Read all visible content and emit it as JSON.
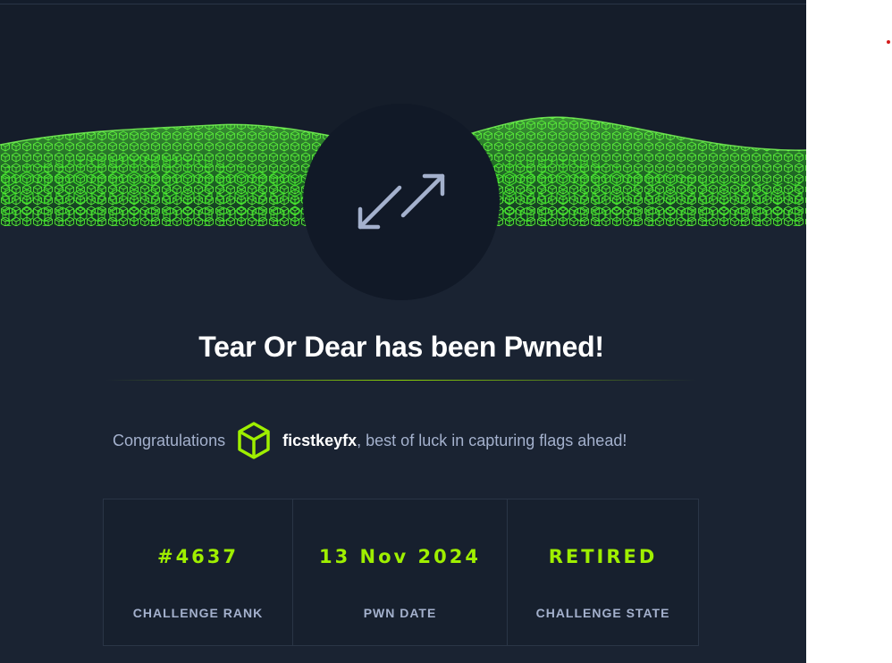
{
  "modal": {
    "title": "Tear Or Dear has been Pwned!",
    "congrats_prefix": "Congratulations",
    "username": "ficstkeyfx",
    "congrats_suffix": ", best of luck in capturing flags ahead!",
    "stats": [
      {
        "value": "#4637",
        "label": "CHALLENGE RANK"
      },
      {
        "value": "13 Nov 2024",
        "label": "PWN DATE"
      },
      {
        "value": "RETIRED",
        "label": "CHALLENGE STATE"
      }
    ]
  },
  "icons": {
    "banner": "green-cube-wave-banner",
    "challenge_category": "diagonal-arrows-icon",
    "user_avatar": "cube-icon"
  },
  "colors": {
    "panel_background": "#1a2332",
    "accent_green": "#9fef00",
    "title_text": "#ffffff",
    "muted_text": "#a4b1cd",
    "icon_circle": "#111927",
    "icon_stroke": "#a4b1cd"
  }
}
